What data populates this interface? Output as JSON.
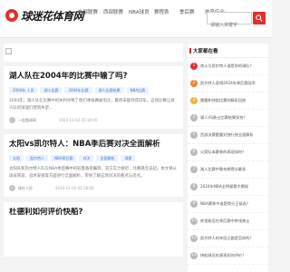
{
  "site": {
    "logo_text": "球迷花体育网"
  },
  "nav": [
    {
      "label": "东部联赛"
    },
    {
      "label": "西部联赛"
    },
    {
      "label": "NBA球员"
    },
    {
      "label": "赛程表"
    },
    {
      "label": "季后赛"
    },
    {
      "label": "体育综合"
    }
  ],
  "search": {
    "placeholder": "请输入关键字"
  },
  "articles": [
    {
      "title": "湖人队在2004年的比赛中输了吗?",
      "tags": [
        "2004年 人员",
        "湖人比赛",
        "2004年比赛",
        "湖人比赛结果",
        "NBA比赛"
      ],
      "excerpt": "2004年，湖人队在比赛中的失利导致了他们季候赛被淘汰，最终未能夺得冠军。这场比赛让湖人队的球迷们感到失望...",
      "author": "一起看球网",
      "date": "2024-11-02 05:18:00"
    },
    {
      "title": "太阳vs凯尔特人：NBA季后赛对决全面解析",
      "tags": [
        "太阳",
        "凯尔特人",
        "NBA季后赛",
        "对决",
        "全面解析",
        "球星"
      ],
      "excerpt": "太阳队和凯尔特人队在NBA季后赛中的较量备受瞩目，双方实力接近，比赛悬念迭起。本文将从球员阵容、战术安排等方面进行全面解析，带你了解这场对决的看点与亮点。",
      "author": "球在人民",
      "date": "2024-11-02 05:18:00"
    },
    {
      "title": "杜德利如何评价快船?"
    }
  ],
  "sidebar": {
    "title": "大家都在看",
    "items": [
      {
        "num": "1",
        "color": "#e52e2e",
        "text": "热火与凯尔特人谁是你的球队？"
      },
      {
        "num": "2",
        "color": "#f0862e",
        "text": "凯尔特人获得2024年季后赛冠军"
      },
      {
        "num": "3",
        "color": "#f5b335",
        "text": "雷霆和快船比赛的精彩回放"
      },
      {
        "num": "4",
        "color": "#bbbbbb",
        "text": "湖人VS勇士比赛结果如何？"
      },
      {
        "num": "5",
        "color": "#bbbbbb",
        "text": "西部决赛雷霆对独行侠全面解析"
      },
      {
        "num": "6",
        "color": "#bbbbbb",
        "text": "火箭队本赛季的表现如何？"
      },
      {
        "num": "7",
        "color": "#bbbbbb",
        "text": "湖人比赛中勒布朗得分最多"
      },
      {
        "num": "8",
        "color": "#bbbbbb",
        "text": "2024年NBA全明星赛大揭秘"
      },
      {
        "num": "9",
        "color": "#bbbbbb",
        "text": "NBA赛季中谁是得分王候选？"
      },
      {
        "num": "10",
        "color": "#bbbbbb",
        "text": "库里能否在季后赛中带领勇士"
      },
      {
        "num": "11",
        "color": "#bbbbbb",
        "text": "凯尔特人的夺冠之路是怎样的？"
      },
      {
        "num": "12",
        "color": "#bbbbbb",
        "text": "快船球员的表现如何评价？"
      }
    ]
  }
}
